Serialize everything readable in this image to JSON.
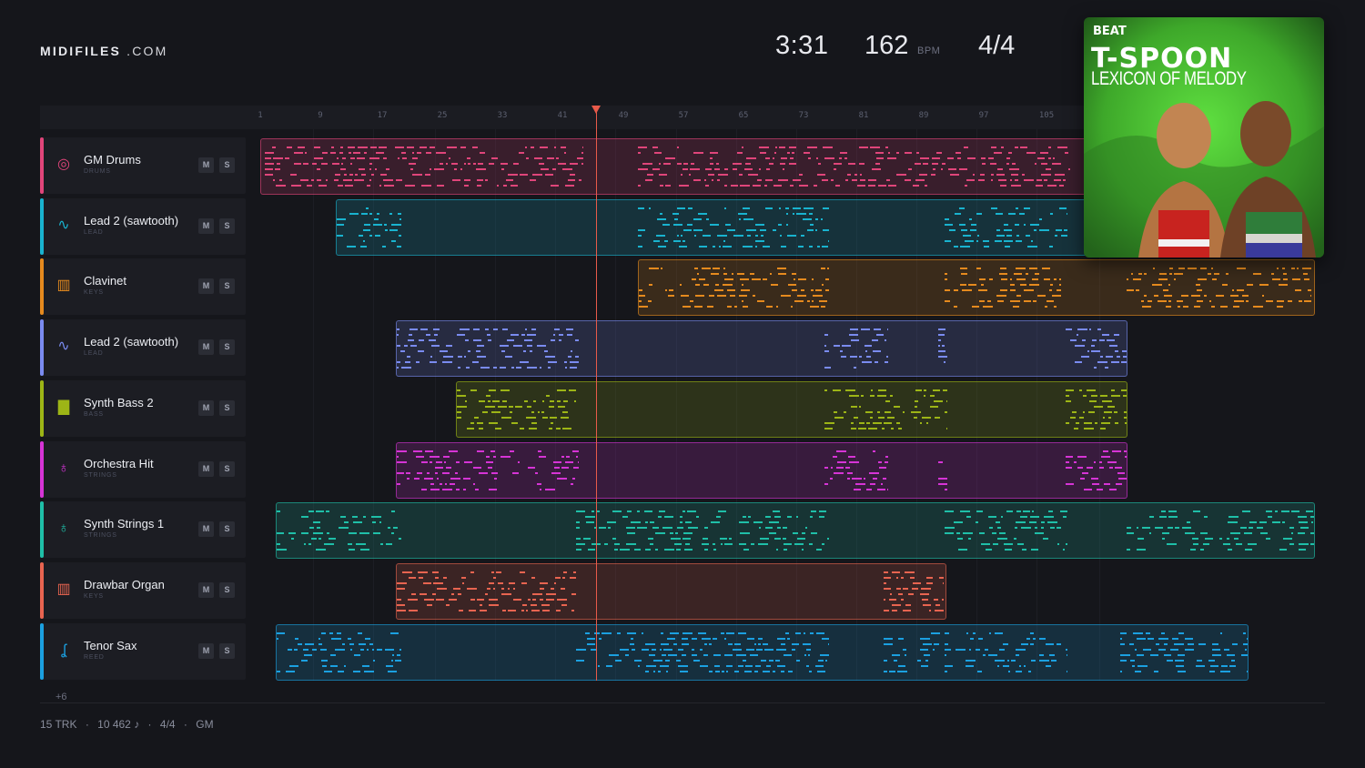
{
  "brand": {
    "bold": "MIDIFILES",
    "light": ".COM"
  },
  "header": {
    "time": "3:31",
    "bpm": "162",
    "bpm_unit": "BPM",
    "signature": "4/4"
  },
  "ruler_ticks": [
    "1",
    "9",
    "17",
    "25",
    "33",
    "41",
    "49",
    "57",
    "65",
    "73",
    "81",
    "89",
    "97",
    "105"
  ],
  "playhead_position": "3:31",
  "tracks": [
    {
      "name": "GM Drums",
      "category": "DRUMS",
      "color": "#e0457a",
      "icon": "drum-icon",
      "m": "M",
      "s": "S"
    },
    {
      "name": "Lead 2 (sawtooth)",
      "category": "LEAD",
      "color": "#19b3cf",
      "icon": "waveform-icon",
      "m": "M",
      "s": "S"
    },
    {
      "name": "Clavinet",
      "category": "KEYS",
      "color": "#e58a1e",
      "icon": "keyboard-icon",
      "m": "M",
      "s": "S"
    },
    {
      "name": "Lead 2 (sawtooth)",
      "category": "LEAD",
      "color": "#7a8bf0",
      "icon": "waveform-icon",
      "m": "M",
      "s": "S"
    },
    {
      "name": "Synth Bass 2",
      "category": "BASS",
      "color": "#9db516",
      "icon": "bass-icon",
      "m": "M",
      "s": "S"
    },
    {
      "name": "Orchestra Hit",
      "category": "STRINGS",
      "color": "#d634d6",
      "icon": "violin-icon",
      "m": "M",
      "s": "S"
    },
    {
      "name": "Synth Strings 1",
      "category": "STRINGS",
      "color": "#1fbfa8",
      "icon": "violin-icon",
      "m": "M",
      "s": "S"
    },
    {
      "name": "Drawbar Organ",
      "category": "KEYS",
      "color": "#e86450",
      "icon": "keyboard-icon",
      "m": "M",
      "s": "S"
    },
    {
      "name": "Tenor Sax",
      "category": "REED",
      "color": "#1ba0e0",
      "icon": "saxophone-icon",
      "m": "M",
      "s": "S"
    }
  ],
  "more_tracks": "+6",
  "footer": {
    "tracks": "15 TRK",
    "notes": "10 462 ♪",
    "signature": "4/4",
    "standard": "GM",
    "sep": "·"
  },
  "cover": {
    "label": "BEAT",
    "artist": "T-SPOON",
    "album": "LEXICON OF MELODY"
  }
}
